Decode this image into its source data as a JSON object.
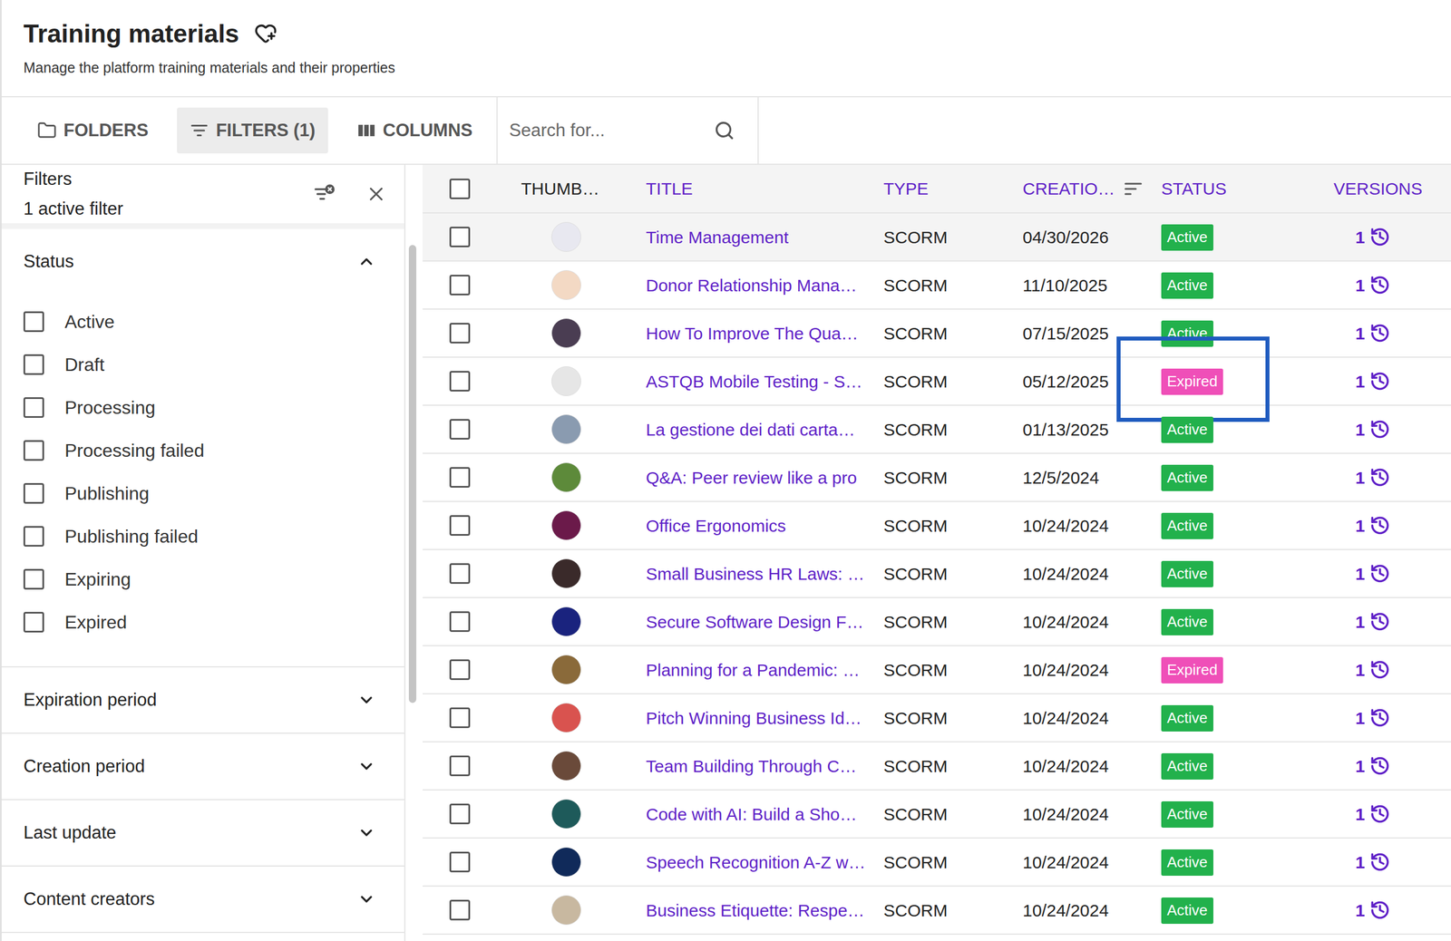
{
  "page": {
    "title": "Training materials",
    "subtitle": "Manage the platform training materials and their properties"
  },
  "toolbar": {
    "buttons": [
      {
        "label": "FOLDERS",
        "kind": "folders",
        "selected": false
      },
      {
        "label": "FILTERS (1)",
        "kind": "filters",
        "selected": true
      },
      {
        "label": "COLUMNS",
        "kind": "columns",
        "selected": false
      }
    ],
    "search": {
      "placeholder": "Search for..."
    }
  },
  "filters": {
    "title": "Filters",
    "summary": "1 active filter",
    "sections": [
      {
        "label": "Status",
        "expanded": true,
        "options": [
          {
            "label": "Active",
            "checked": false
          },
          {
            "label": "Draft",
            "checked": false
          },
          {
            "label": "Processing",
            "checked": false
          },
          {
            "label": "Processing failed",
            "checked": false
          },
          {
            "label": "Publishing",
            "checked": false
          },
          {
            "label": "Publishing failed",
            "checked": false
          },
          {
            "label": "Expiring",
            "checked": false
          },
          {
            "label": "Expired",
            "checked": false
          }
        ]
      },
      {
        "label": "Expiration period",
        "expanded": false,
        "options": []
      },
      {
        "label": "Creation period",
        "expanded": false,
        "options": []
      },
      {
        "label": "Last update",
        "expanded": false,
        "options": []
      },
      {
        "label": "Content creators",
        "expanded": false,
        "options": []
      }
    ]
  },
  "table": {
    "all_checked": false,
    "columns": [
      {
        "label": "THUMB…",
        "sortable": false,
        "sorted": false
      },
      {
        "label": "TITLE",
        "sortable": true,
        "sorted": false
      },
      {
        "label": "TYPE",
        "sortable": true,
        "sorted": false
      },
      {
        "label": "CREATIO…",
        "sortable": true,
        "sorted": true
      },
      {
        "label": "STATUS",
        "sortable": true,
        "sorted": false
      },
      {
        "label": "VERSIONS",
        "sortable": true,
        "sorted": false
      }
    ],
    "rows": [
      {
        "title": "Time Management",
        "type": "SCORM",
        "created": "04/30/2026",
        "status": "Active",
        "color": "#22b14c",
        "thumb": "#e8e8f0",
        "versions": "1",
        "checked": false,
        "hovered": true,
        "highlighted": false
      },
      {
        "title": "Donor Relationship Mana…",
        "type": "SCORM",
        "created": "11/10/2025",
        "status": "Active",
        "color": "#22b14c",
        "thumb": "#f3d9c4",
        "versions": "1",
        "checked": false,
        "hovered": false,
        "highlighted": false
      },
      {
        "title": "How To Improve The Qua…",
        "type": "SCORM",
        "created": "07/15/2025",
        "status": "Active",
        "color": "#22b14c",
        "thumb": "#4a3d52",
        "versions": "1",
        "checked": false,
        "hovered": false,
        "highlighted": false
      },
      {
        "title": "ASTQB Mobile Testing - S…",
        "type": "SCORM",
        "created": "05/12/2025",
        "status": "Expired",
        "color": "#ef4fb8",
        "thumb": "#e6e6e6",
        "versions": "1",
        "checked": false,
        "hovered": false,
        "highlighted": true
      },
      {
        "title": "La gestione dei dati carta…",
        "type": "SCORM",
        "created": "01/13/2025",
        "status": "Active",
        "color": "#22b14c",
        "thumb": "#8a9bb0",
        "versions": "1",
        "checked": false,
        "hovered": false,
        "highlighted": false
      },
      {
        "title": "Q&A: Peer review like a pro",
        "type": "SCORM",
        "created": "12/5/2024",
        "status": "Active",
        "color": "#22b14c",
        "thumb": "#5d8a3a",
        "versions": "1",
        "checked": false,
        "hovered": false,
        "highlighted": false
      },
      {
        "title": "Office Ergonomics",
        "type": "SCORM",
        "created": "10/24/2024",
        "status": "Active",
        "color": "#22b14c",
        "thumb": "#6b1a4a",
        "versions": "1",
        "checked": false,
        "hovered": false,
        "highlighted": false
      },
      {
        "title": "Small Business HR Laws: …",
        "type": "SCORM",
        "created": "10/24/2024",
        "status": "Active",
        "color": "#22b14c",
        "thumb": "#3a2a2a",
        "versions": "1",
        "checked": false,
        "hovered": false,
        "highlighted": false
      },
      {
        "title": "Secure Software Design F…",
        "type": "SCORM",
        "created": "10/24/2024",
        "status": "Active",
        "color": "#22b14c",
        "thumb": "#1a237e",
        "versions": "1",
        "checked": false,
        "hovered": false,
        "highlighted": false
      },
      {
        "title": "Planning for a Pandemic: …",
        "type": "SCORM",
        "created": "10/24/2024",
        "status": "Expired",
        "color": "#ef4fb8",
        "thumb": "#8a6a3a",
        "versions": "1",
        "checked": false,
        "hovered": false,
        "highlighted": false
      },
      {
        "title": "Pitch Winning Business Id…",
        "type": "SCORM",
        "created": "10/24/2024",
        "status": "Active",
        "color": "#22b14c",
        "thumb": "#d9534f",
        "versions": "1",
        "checked": false,
        "hovered": false,
        "highlighted": false
      },
      {
        "title": "Team Building Through C…",
        "type": "SCORM",
        "created": "10/24/2024",
        "status": "Active",
        "color": "#22b14c",
        "thumb": "#6a4a3a",
        "versions": "1",
        "checked": false,
        "hovered": false,
        "highlighted": false
      },
      {
        "title": "Code with AI: Build a Sho…",
        "type": "SCORM",
        "created": "10/24/2024",
        "status": "Active",
        "color": "#22b14c",
        "thumb": "#1e5a5a",
        "versions": "1",
        "checked": false,
        "hovered": false,
        "highlighted": false
      },
      {
        "title": "Speech Recognition A-Z w…",
        "type": "SCORM",
        "created": "10/24/2024",
        "status": "Active",
        "color": "#22b14c",
        "thumb": "#102a5a",
        "versions": "1",
        "checked": false,
        "hovered": false,
        "highlighted": false
      },
      {
        "title": "Business Etiquette: Respe…",
        "type": "SCORM",
        "created": "10/24/2024",
        "status": "Active",
        "color": "#22b14c",
        "thumb": "#c8b8a0",
        "versions": "1",
        "checked": false,
        "hovered": false,
        "highlighted": false
      }
    ]
  }
}
